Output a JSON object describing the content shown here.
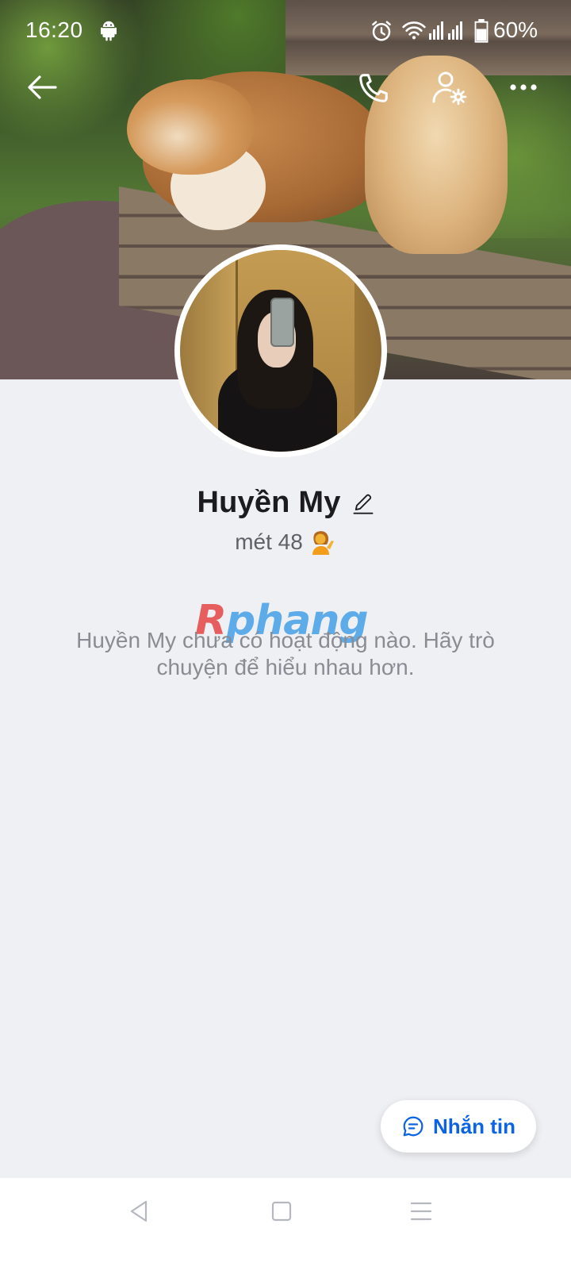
{
  "status_bar": {
    "time": "16:20",
    "battery": "60%",
    "icons": [
      "android-icon",
      "alarm-icon",
      "wifi-icon",
      "signal-icon",
      "battery-icon"
    ]
  },
  "top_actions": {
    "icons": [
      "back-arrow-icon",
      "phone-icon",
      "user-settings-icon",
      "more-dots-icon"
    ]
  },
  "profile": {
    "name": "Huyền My",
    "bio": "mét 48",
    "bio_emoji": "person-tipping-hand-emoji"
  },
  "watermark": {
    "part1": "R",
    "part2": "phang"
  },
  "empty_state": {
    "message": "Huyền My chưa có hoạt động nào. Hãy trò chuyện để hiểu nhau hơn."
  },
  "message_button": {
    "label": "Nhắn tin",
    "icon": "chat-bubble-icon"
  },
  "nav_bar": {
    "icons": [
      "nav-back-icon",
      "nav-home-icon",
      "nav-menu-icon"
    ]
  },
  "colors": {
    "accent": "#0b63e5",
    "background": "#eff0f4",
    "text_primary": "#1c1c1f",
    "text_secondary": "#8a8c93"
  }
}
